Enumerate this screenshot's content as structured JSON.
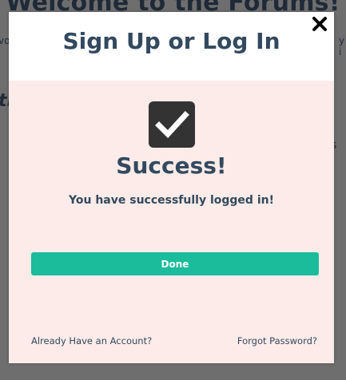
{
  "background_page": {
    "title_fragment": "Welcome to the Forums!",
    "subtitle_left_fragment": "vo",
    "subtitle_right_fragment": "y i",
    "italic_fragment": "th",
    "text_fragment": "s"
  },
  "modal": {
    "title": "Sign Up or Log In",
    "close_icon": "close-icon",
    "status_icon": "checked-checkbox-icon",
    "success_title": "Success!",
    "success_message": "You have successfully logged in!",
    "done_label": "Done",
    "footer": {
      "already_account_label": "Already Have an Account?",
      "forgot_password_label": "Forgot Password?"
    }
  },
  "colors": {
    "modal_body": "#fcebe8",
    "header_bg": "#ffffff",
    "title_text": "#33495f",
    "accent_button": "#1abc9c",
    "overlay": "#6e6e6e",
    "checkbox": "#333333"
  }
}
